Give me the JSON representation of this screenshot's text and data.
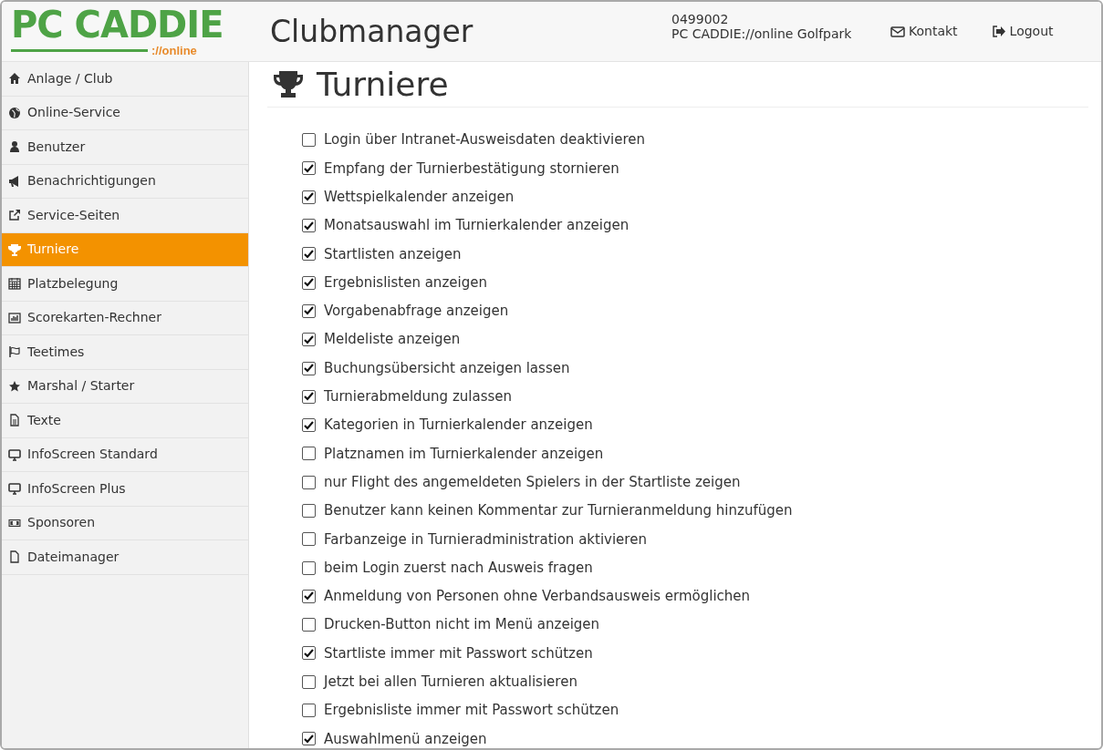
{
  "logo": {
    "brand": "PC CADDIE",
    "suffix": "://online"
  },
  "header": {
    "title": "Clubmanager",
    "account_number": "0499002",
    "account_name": "PC CADDIE://online Golfpark",
    "links": [
      {
        "label": "Kontakt"
      },
      {
        "label": "Logout"
      }
    ]
  },
  "sidebar": {
    "items": [
      {
        "label": "Anlage / Club",
        "selected": false
      },
      {
        "label": "Online-Service",
        "selected": false
      },
      {
        "label": "Benutzer",
        "selected": false
      },
      {
        "label": "Benachrichtigungen",
        "selected": false
      },
      {
        "label": "Service-Seiten",
        "selected": false
      },
      {
        "label": "Turniere",
        "selected": true
      },
      {
        "label": "Platzbelegung",
        "selected": false
      },
      {
        "label": "Scorekarten-Rechner",
        "selected": false
      },
      {
        "label": "Teetimes",
        "selected": false
      },
      {
        "label": "Marshal / Starter",
        "selected": false
      },
      {
        "label": "Texte",
        "selected": false
      },
      {
        "label": "InfoScreen Standard",
        "selected": false
      },
      {
        "label": "InfoScreen Plus",
        "selected": false
      },
      {
        "label": "Sponsoren",
        "selected": false
      },
      {
        "label": "Dateimanager",
        "selected": false
      }
    ]
  },
  "page": {
    "title": "Turniere",
    "options": [
      {
        "label": "Login über Intranet-Ausweisdaten deaktivieren",
        "checked": false
      },
      {
        "label": "Empfang der Turnierbestätigung stornieren",
        "checked": true
      },
      {
        "label": "Wettspielkalender anzeigen",
        "checked": true
      },
      {
        "label": "Monatsauswahl im Turnierkalender anzeigen",
        "checked": true
      },
      {
        "label": "Startlisten anzeigen",
        "checked": true
      },
      {
        "label": "Ergebnislisten anzeigen",
        "checked": true
      },
      {
        "label": "Vorgabenabfrage anzeigen",
        "checked": true
      },
      {
        "label": "Meldeliste anzeigen",
        "checked": true
      },
      {
        "label": "Buchungsübersicht anzeigen lassen",
        "checked": true
      },
      {
        "label": "Turnierabmeldung zulassen",
        "checked": true
      },
      {
        "label": "Kategorien in Turnierkalender anzeigen",
        "checked": true
      },
      {
        "label": "Platznamen im Turnierkalender anzeigen",
        "checked": false
      },
      {
        "label": "nur Flight des angemeldeten Spielers in der Startliste zeigen",
        "checked": false
      },
      {
        "label": "Benutzer kann keinen Kommentar zur Turnieranmeldung hinzufügen",
        "checked": false
      },
      {
        "label": "Farbanzeige in Turnieradministration aktivieren",
        "checked": false
      },
      {
        "label": "beim Login zuerst nach Ausweis fragen",
        "checked": false
      },
      {
        "label": "Anmeldung von Personen ohne Verbandsausweis ermöglichen",
        "checked": true
      },
      {
        "label": "Drucken-Button nicht im Menü anzeigen",
        "checked": false
      },
      {
        "label": "Startliste immer mit Passwort schützen",
        "checked": true
      },
      {
        "label": "Jetzt bei allen Turnieren aktualisieren",
        "checked": false
      },
      {
        "label": "Ergebnisliste immer mit Passwort schützen",
        "checked": false
      },
      {
        "label": "Auswahlmenü anzeigen",
        "checked": true
      }
    ]
  }
}
